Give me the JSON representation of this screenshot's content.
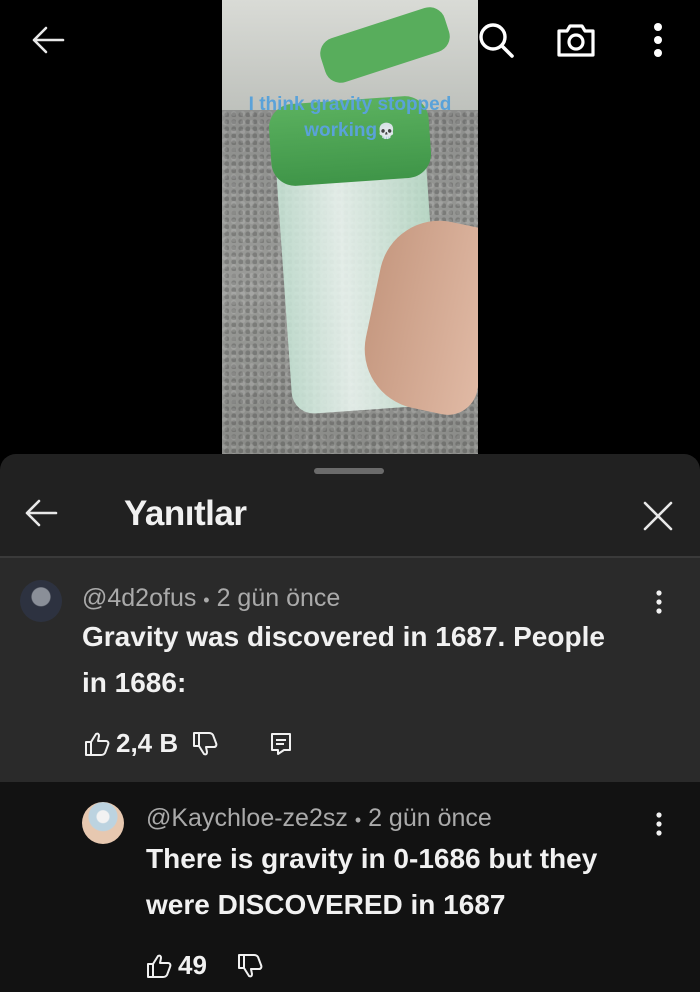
{
  "video": {
    "caption_line1": "I think gravity stopped",
    "caption_line2": "working",
    "caption_emoji": "💀"
  },
  "sheet": {
    "title": "Yanıtlar"
  },
  "comment": {
    "author": "@4d2ofus",
    "separator": "•",
    "time": "2 gün önce",
    "text_line1": "Gravity was discovered in 1687. People",
    "text_line2": "in 1686:",
    "likes": "2,4 B"
  },
  "reply": {
    "author": "@Kaychloe-ze2sz",
    "separator": "•",
    "time": "2 gün önce",
    "text_line1": "There is gravity in 0-1686 but they",
    "text_line2": "were DISCOVERED in 1687",
    "likes": "49"
  },
  "colors": {
    "sheet_bg": "#212121",
    "comment_bg": "#2a2a2a",
    "reply_bg": "#121212",
    "caption_blue": "#5aa2d9"
  },
  "icons": [
    "back-arrow-icon",
    "search-icon",
    "camera-icon",
    "more-vert-icon",
    "close-icon",
    "thumbs-up-icon",
    "thumbs-down-icon",
    "reply-icon"
  ]
}
